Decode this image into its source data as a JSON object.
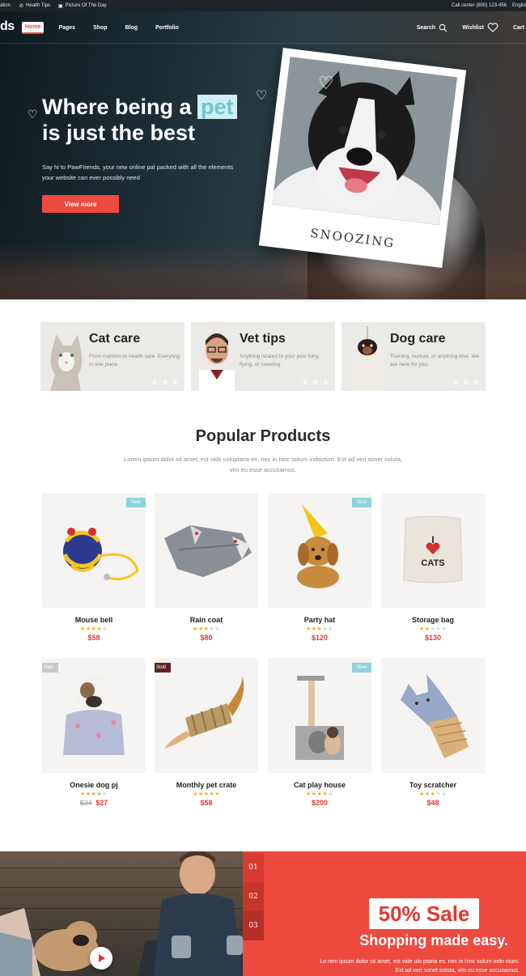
{
  "topbar": {
    "left_fragment": "ation",
    "health_tips": "Health Tips",
    "picture_of_day": "Picture Of The Day",
    "call_center": "Call center (800) 123-456",
    "language": "English"
  },
  "nav": {
    "logo_fragment": "ds",
    "links": [
      "Home",
      "Pages",
      "Shop",
      "Blog",
      "Portfolio"
    ],
    "search": "Search",
    "wishlist": "Wishlist",
    "cart": "Cart"
  },
  "hero": {
    "title_line1_a": "Where being a",
    "title_highlight": "pet",
    "title_line2": "is just the best",
    "subtitle": "Say hi to PawFriends, your new online pal packed with all the elements your website can ever possibly need",
    "cta": "View more",
    "polaroid_caption": "SNOOZING"
  },
  "categories": [
    {
      "title": "Cat care",
      "desc": "From nutrition to health care. Everyting in one place."
    },
    {
      "title": "Vet tips",
      "desc": "Anything related to your pets furry, flying, or crawling."
    },
    {
      "title": "Dog care",
      "desc": "Training, nurture, or anything else. We are here for you."
    }
  ],
  "popular": {
    "title": "Popular Products",
    "subtitle": "Lorem ipsum dolor sit amet, est vide voluptaria ex, nec in hinc solum indoctum. Est ad veri sonet soluta, vim eu esse accusamus."
  },
  "products": [
    {
      "name": "Mouse bell",
      "price": "$58",
      "rating": 4,
      "badge": "New"
    },
    {
      "name": "Rain coat",
      "price": "$80",
      "rating": 3,
      "badge": ""
    },
    {
      "name": "Party hat",
      "price": "$120",
      "rating": 3,
      "badge": "New"
    },
    {
      "name": "Storage bag",
      "price": "$130",
      "rating": 2,
      "badge": ""
    },
    {
      "name": "Onesie dog pj",
      "old_price": "$34",
      "price": "$27",
      "rating": 4,
      "badge": "Sale"
    },
    {
      "name": "Monthly pet crate",
      "price": "$58",
      "rating": 5,
      "badge": "Sold"
    },
    {
      "name": "Cat play house",
      "price": "$200",
      "rating": 4,
      "badge": "New"
    },
    {
      "name": "Toy scratcher",
      "price": "$48",
      "rating": 3,
      "badge": ""
    }
  ],
  "storage_bag_print": {
    "line1": "I",
    "line2": "CATS"
  },
  "banner": {
    "tabs": [
      "01",
      "02",
      "03"
    ],
    "sale": "50% Sale",
    "headline": "Shopping made easy.",
    "text": "Lo rem ipsum dolor sit amet, est vide ulo ptaria ex, nec in hinc solum indo ctum. Est ad veri sonet soluta, vim eu esse accusamus."
  },
  "colors": {
    "accent": "#ee4a3f",
    "highlight": "#cfeff5",
    "star": "#f2b01e"
  }
}
